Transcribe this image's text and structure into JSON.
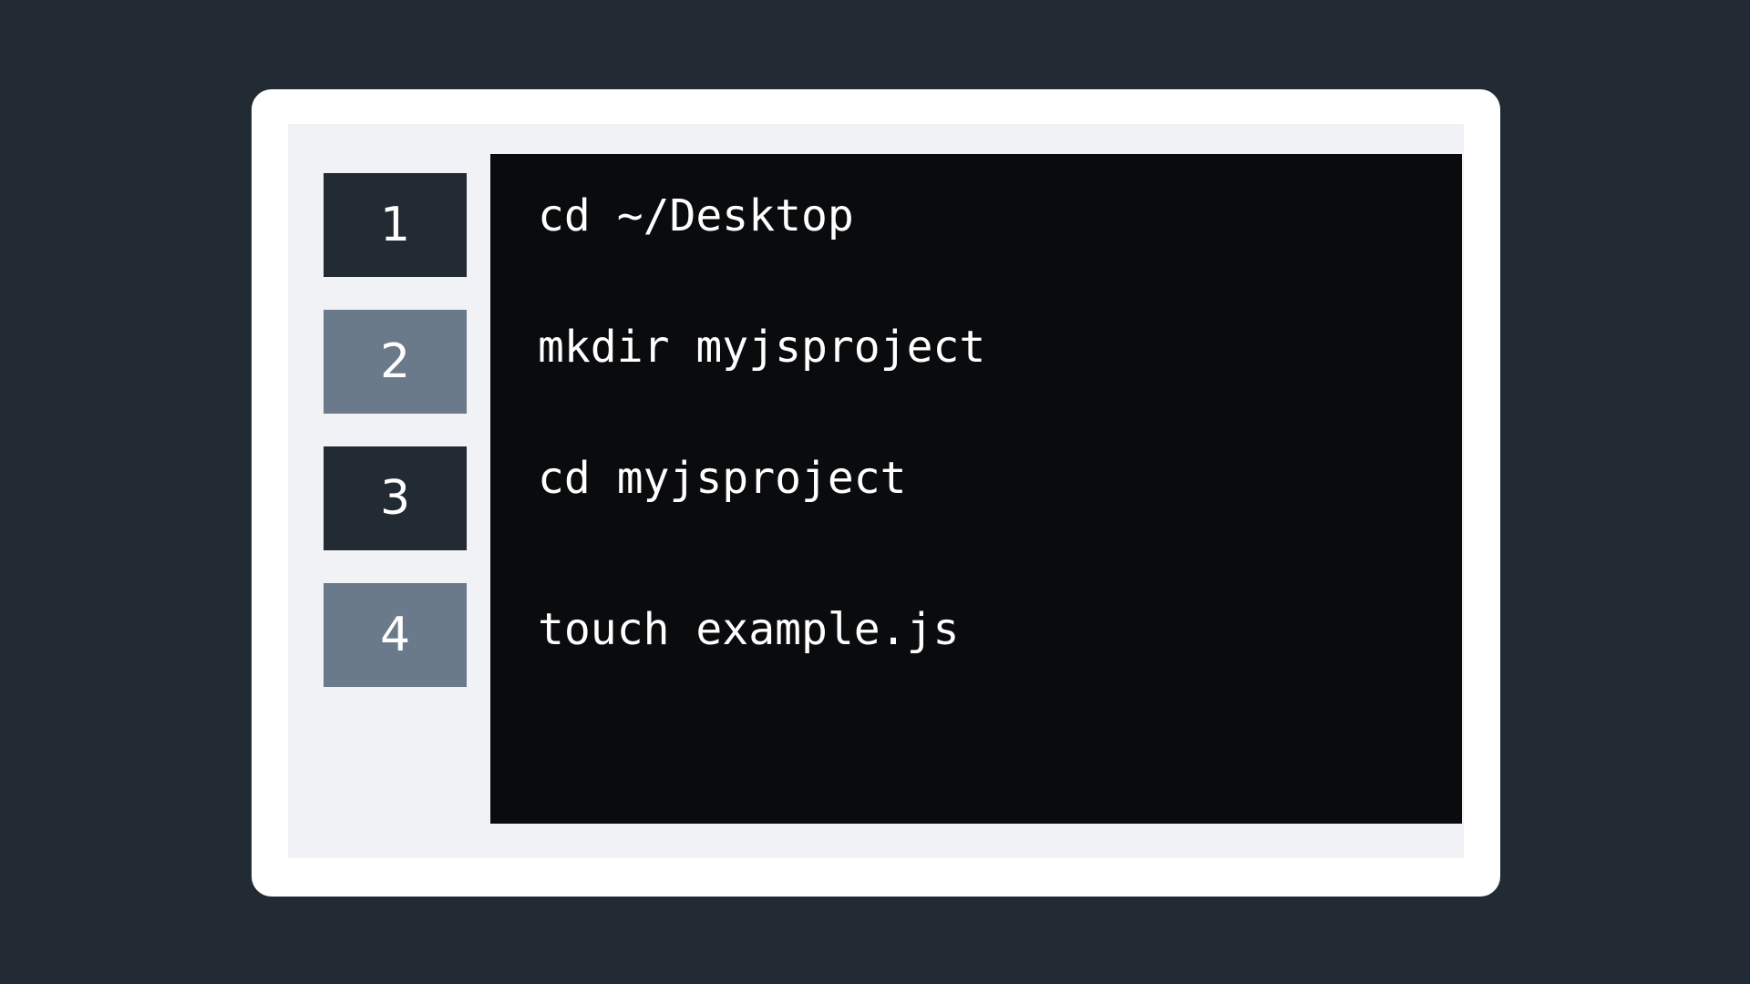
{
  "steps": [
    {
      "number": "1",
      "command": "cd ~/Desktop"
    },
    {
      "number": "2",
      "command": "mkdir myjsproject"
    },
    {
      "number": "3",
      "command": "cd myjsproject"
    },
    {
      "number": "4",
      "command": "touch example.js"
    }
  ],
  "colors": {
    "background": "#222b33",
    "card": "#ffffff",
    "panel": "#f1f2f6",
    "step_dark": "#222b33",
    "step_light": "#6b7a8b",
    "terminal": "#0a0b0d",
    "terminal_text": "#ffffff"
  }
}
